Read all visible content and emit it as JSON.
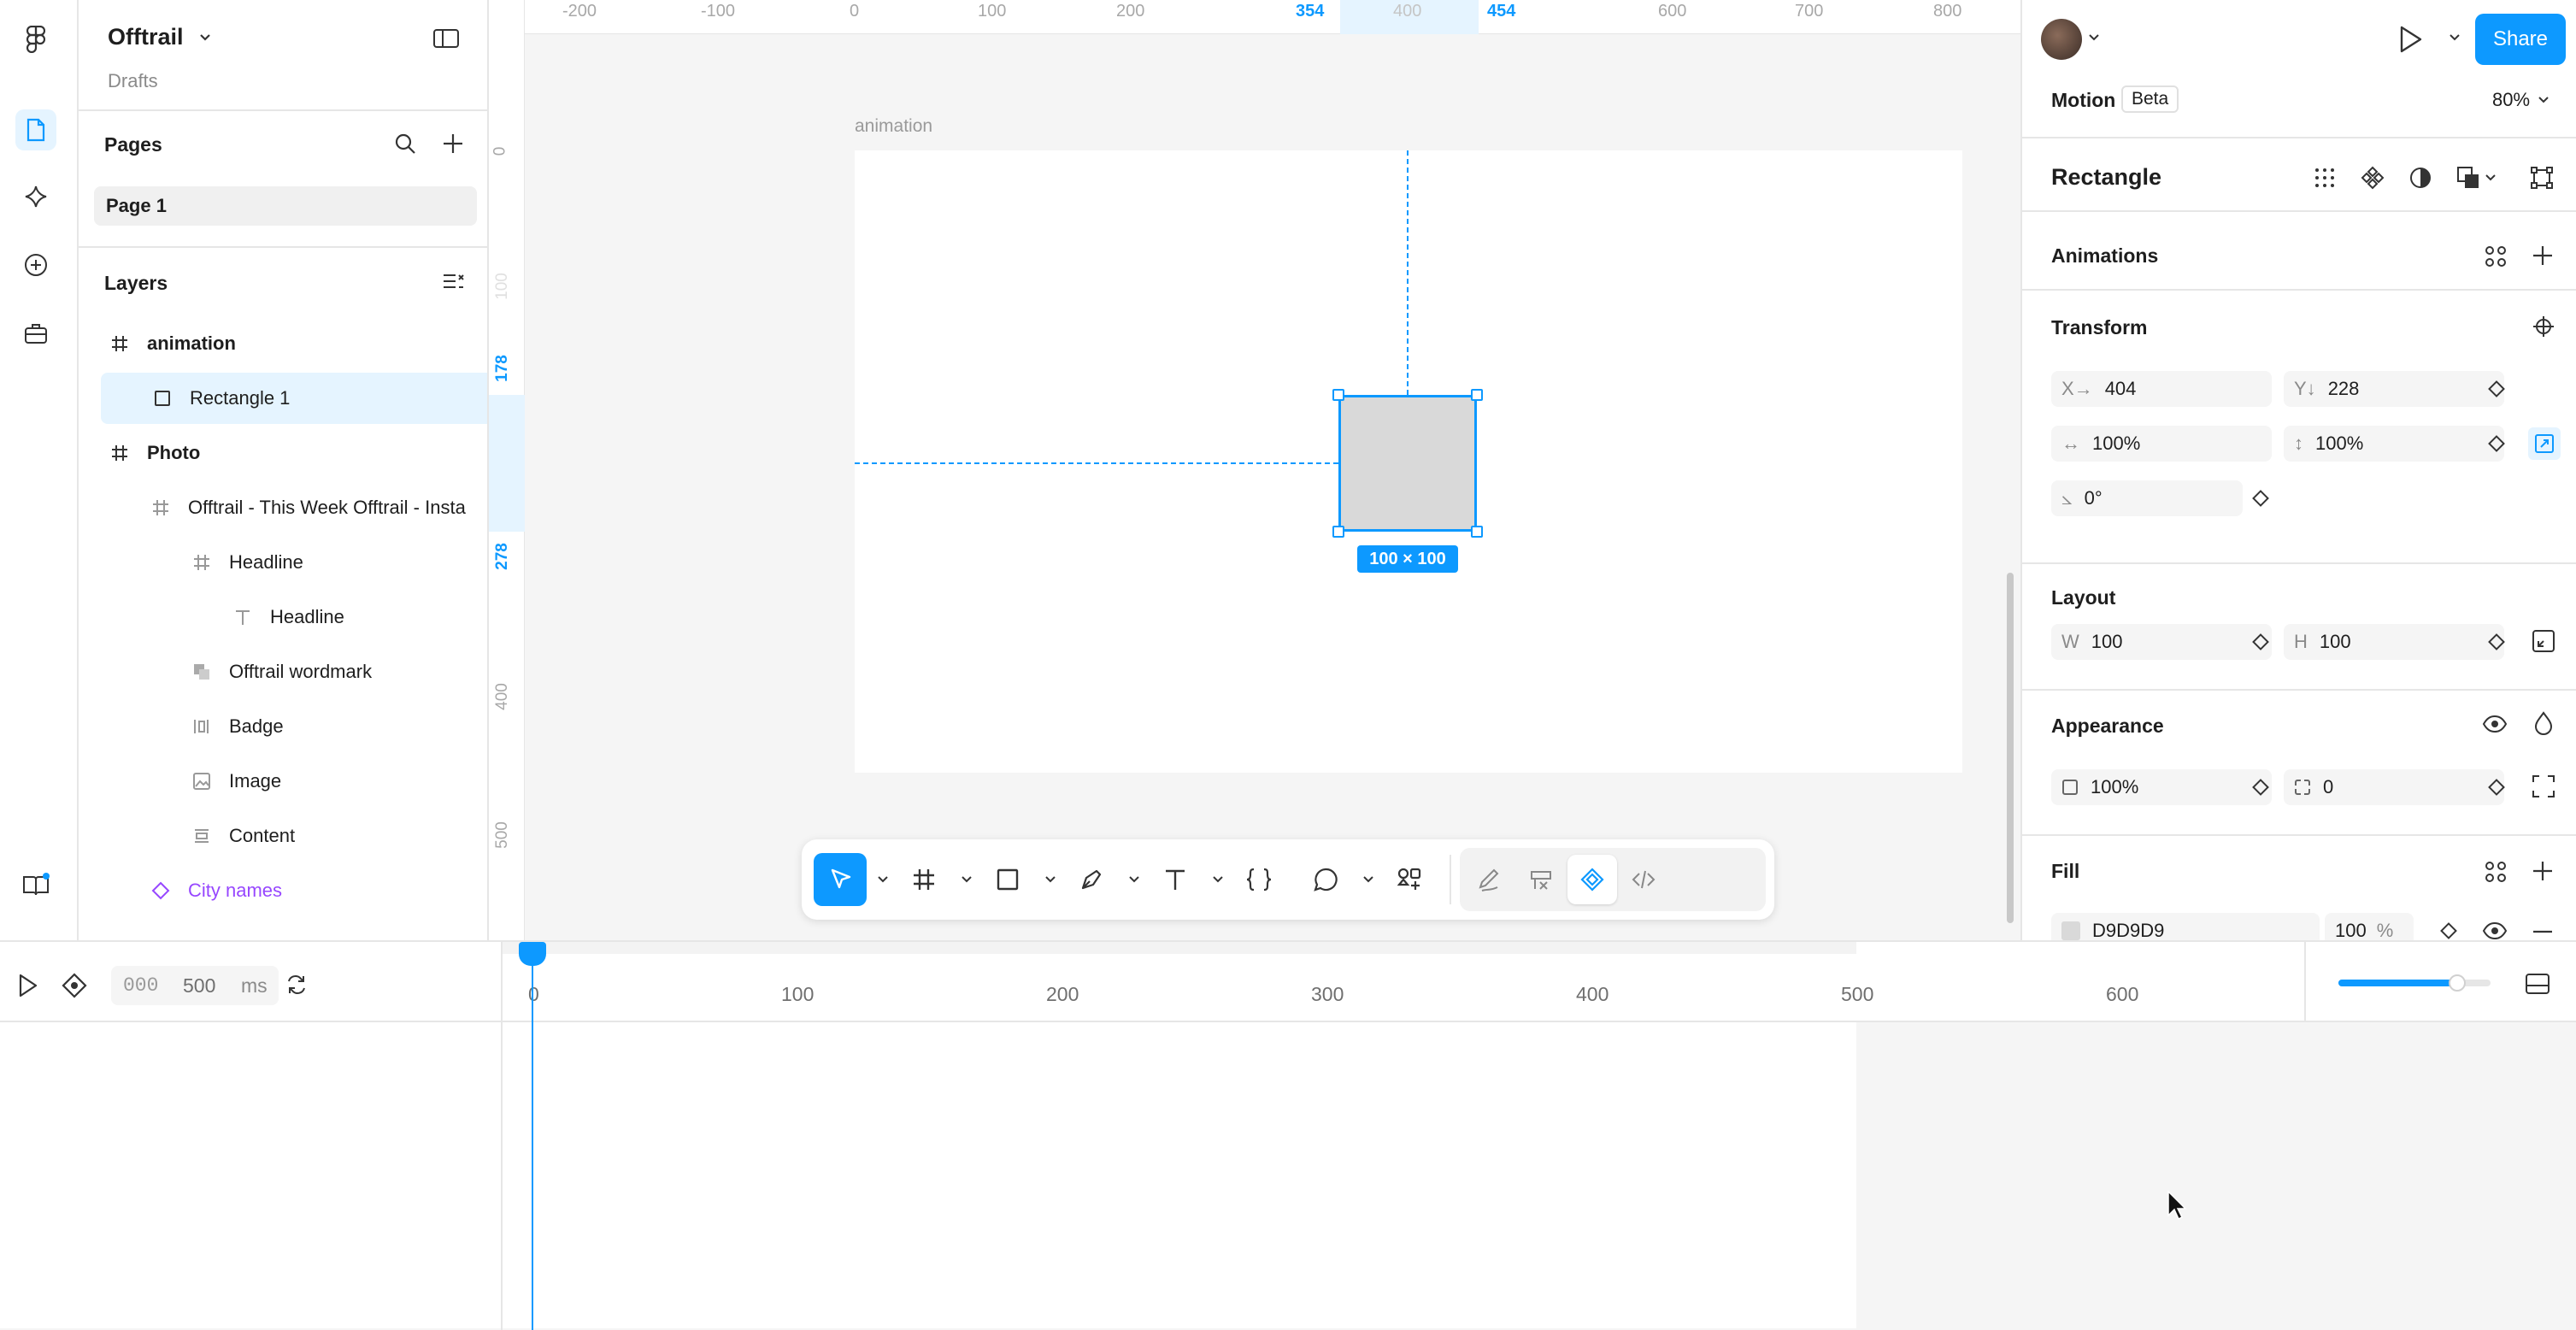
{
  "app": {
    "file_name": "Offtrail",
    "location": "Drafts"
  },
  "pages": {
    "title": "Pages",
    "items": [
      "Page 1"
    ]
  },
  "layers": {
    "title": "Layers",
    "items": [
      {
        "name": "animation",
        "type": "frame"
      },
      {
        "name": "Rectangle 1",
        "type": "rectangle",
        "selected": true
      },
      {
        "name": "Photo",
        "type": "frame"
      },
      {
        "name": "Offtrail - This Week Offtrail - Insta",
        "type": "frame"
      },
      {
        "name": "Headline",
        "type": "frame"
      },
      {
        "name": "Headline",
        "type": "text"
      },
      {
        "name": "Offtrail wordmark",
        "type": "group"
      },
      {
        "name": "Badge",
        "type": "autolayout"
      },
      {
        "name": "Image",
        "type": "image"
      },
      {
        "name": "Content",
        "type": "autolayout"
      },
      {
        "name": "City names",
        "type": "component"
      }
    ]
  },
  "rulers": {
    "top": [
      "-200",
      "-100",
      "0",
      "100",
      "200",
      "354",
      "400",
      "454",
      "600",
      "700",
      "800"
    ],
    "top_highlight": [
      "354",
      "454"
    ],
    "left": [
      "0",
      "100",
      "178",
      "278",
      "400",
      "500"
    ],
    "left_highlight": [
      "178",
      "278"
    ]
  },
  "canvas": {
    "frame_label": "animation",
    "size_badge": "100 × 100"
  },
  "toolbar": {
    "tools": [
      "move",
      "frame",
      "rectangle",
      "pen",
      "text",
      "code",
      "comment",
      "actions",
      "draw",
      "dev-mode",
      "motion",
      "code-view"
    ],
    "active": "move",
    "active_mode": "motion"
  },
  "right_panel": {
    "share_label": "Share",
    "motion_label": "Motion",
    "beta_label": "Beta",
    "zoom": "80%",
    "selection_title": "Rectangle",
    "animations_title": "Animations",
    "transform": {
      "title": "Transform",
      "x_label": "X→",
      "x": "404",
      "y_label": "Y↓",
      "y": "228",
      "scale_w": "100%",
      "scale_h": "100%",
      "rotation": "0°"
    },
    "layout": {
      "title": "Layout",
      "w_label": "W",
      "w": "100",
      "h_label": "H",
      "h": "100"
    },
    "appearance": {
      "title": "Appearance",
      "opacity": "100%",
      "radius": "0"
    },
    "fill": {
      "title": "Fill",
      "hex": "D9D9D9",
      "opacity": "100",
      "unit": "%",
      "color": "#D9D9D9"
    }
  },
  "timeline": {
    "start": "000",
    "end": "500",
    "unit": "ms",
    "marks": [
      "0",
      "100",
      "200",
      "300",
      "400",
      "500",
      "600"
    ],
    "playhead_ms": 0,
    "zoom_level": 0.78
  },
  "colors": {
    "accent": "#0d99ff",
    "purple": "#9747ff"
  }
}
